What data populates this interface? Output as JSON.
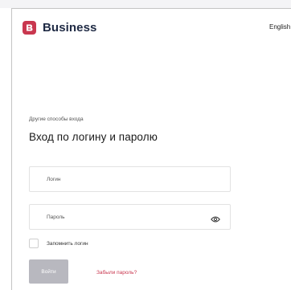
{
  "header": {
    "brand_name": "Business",
    "language": "English"
  },
  "form": {
    "other_methods": "Другие способы входа",
    "title": "Вход по логину и паролю",
    "login_placeholder": "Логин",
    "password_placeholder": "Пароль",
    "remember_label": "Запомнить логин",
    "submit_label": "Войти",
    "forgot_link": "Забыли пароль?"
  },
  "colors": {
    "brand": "#c9374f",
    "button_disabled": "#b8b8bf"
  },
  "icons": {
    "logo": "logo-icon",
    "password_toggle": "eye-icon"
  }
}
